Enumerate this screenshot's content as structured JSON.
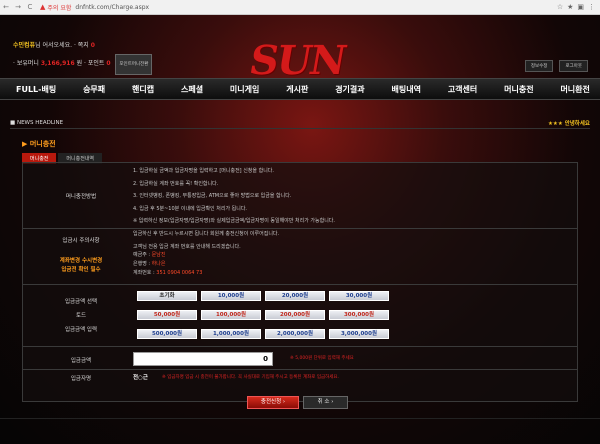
{
  "browser": {
    "back": "←",
    "forward": "→",
    "reload": "C",
    "warning_icon": "warning-icon",
    "warning_text": "주의 요함",
    "url": "dnfntk.com/Charge.aspx",
    "right_icons": [
      "☆",
      "★",
      "▣",
      "⋮"
    ]
  },
  "header": {
    "user_name": "수민컴퓨",
    "welcome_suffix": "님 어서오세요.",
    "message_label": "쪽지",
    "message_count": "0",
    "holdings_label": "보유머니",
    "holdings_value": "3,166,916",
    "holdings_unit": "원",
    "points_label": "포인트",
    "points_value": "0",
    "points_button": "포인트머니전환",
    "logo": "SUN",
    "info_button": "정보수정",
    "logout_button": "로그아웃"
  },
  "menu": [
    "FULL-배팅",
    "승무패",
    "핸디캡",
    "스페셜",
    "미니게임",
    "게시판",
    "경기결과",
    "배팅내역",
    "고객센터",
    "머니충전",
    "머니환전"
  ],
  "headline": {
    "label": "NEWS HEADLINE",
    "right_text": "★★★ 안녕하세요"
  },
  "panel": {
    "title": "머니충전",
    "tabs": [
      "머니충전",
      "머니충전내역"
    ],
    "method_label": "머니충전방법",
    "rules": [
      "1. 입금하실 금액과 입금자명을 입력하고 [머니충전] 신청을 합니다.",
      "2. 입금하실 계좌 번호를 꼭! 확인합니다.",
      "3. 인터넷뱅킹, 폰뱅킹, 무통장입금, ATM으로 좋아 방법으로 입금을 합니다.",
      "4. 입금 후 5분~10분 이내에 입금확인 처리가 됩니다.",
      "※ 입력하신 정보(입금자명/입금자명)와 실제입금금액/입금자명이 동일해야만 처리가 가능합니다."
    ],
    "caution_label": "입금시 주의사항",
    "caution_lines": [
      "입금하신 후 반드시 누르시면 됩니다 회원께 충전신청이 이루어집니다.",
      "고객님 전용 입금 계좌 번호를 안내해 드리겠습니다."
    ],
    "account_notice_lines": [
      "계좌변경 수시변경",
      "입금전 확인 필수"
    ],
    "bank_lines": [
      {
        "label": "예금주 :",
        "value": "문남진"
      },
      {
        "label": "은행명 :",
        "value": "하나은"
      },
      {
        "label": "계좌번호 :",
        "value": "351 0904 0064 73"
      }
    ],
    "amount_select_label": "입금금액 선택",
    "total_label": "토드",
    "amount_input_label": "입금금액 입력",
    "amount_buttons_row1": [
      "초기화",
      "10,000원",
      "20,000원",
      "30,000원"
    ],
    "amount_buttons_row2": [
      "50,000원",
      "100,000원",
      "200,000원",
      "300,000원"
    ],
    "amount_buttons_row3": [
      "500,000원",
      "1,000,000원",
      "2,000,000원",
      "3,000,000원"
    ],
    "deposit_amount_label": "입금금액",
    "deposit_amount_value": "0",
    "deposit_amount_note": "※ 5,000원 단위로 입력해 주세요",
    "depositor_label": "입금자명",
    "depositor_value": "전○근",
    "depositor_note": "※ 입금자명 입금 시 충전이 불가합니다. 꼭 사실대로 기입해 주시고 등록된 계좌로 입금하세요.",
    "submit_label": "충전신청",
    "cancel_label": "취 소"
  },
  "colors": {
    "accent_red": "#b8190d",
    "accent_orange": "#ff9d1d",
    "gold": "#f0c020"
  }
}
